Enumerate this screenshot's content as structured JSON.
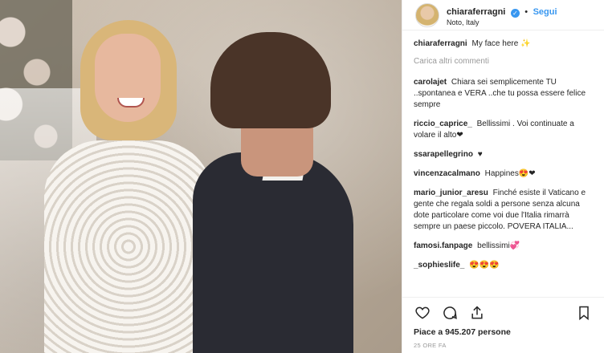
{
  "header": {
    "username": "chiaraferragni",
    "separator": "•",
    "follow_label": "Segui",
    "location": "Noto, Italy"
  },
  "caption": {
    "username": "chiaraferragni",
    "text": "My face here ✨"
  },
  "load_more_label": "Carica altri commenti",
  "comments": [
    {
      "username": "carolajet",
      "text": "Chiara sei semplicemente TU ..spontanea e VERA ..che tu possa essere felice sempre"
    },
    {
      "username": "riccio_caprice_",
      "text": "Bellissimi . Voi continuate a volare il alto❤"
    },
    {
      "username": "ssarapellegrino",
      "text": "♥"
    },
    {
      "username": "vincenzacalmano",
      "text": "Happines😍❤"
    },
    {
      "username": "mario_junior_aresu",
      "text": "Finché esiste il Vaticano e gente che regala soldi a persone senza alcuna dote particolare come voi due l'Italia rimarrà sempre un paese piccolo. POVERA ITALIA..."
    },
    {
      "username": "famosi.fanpage",
      "text": "bellissimi💞"
    },
    {
      "username": "_sophieslife_",
      "text": "😍😍😍"
    }
  ],
  "actions": {
    "like_icon": "heart-icon",
    "comment_icon": "comment-icon",
    "share_icon": "share-icon",
    "save_icon": "bookmark-icon"
  },
  "likes_text": "Piace a 945.207 persone",
  "time_ago": "25 ORE FA",
  "colors": {
    "link_blue": "#3897f0",
    "muted": "#999999",
    "text": "#262626"
  }
}
